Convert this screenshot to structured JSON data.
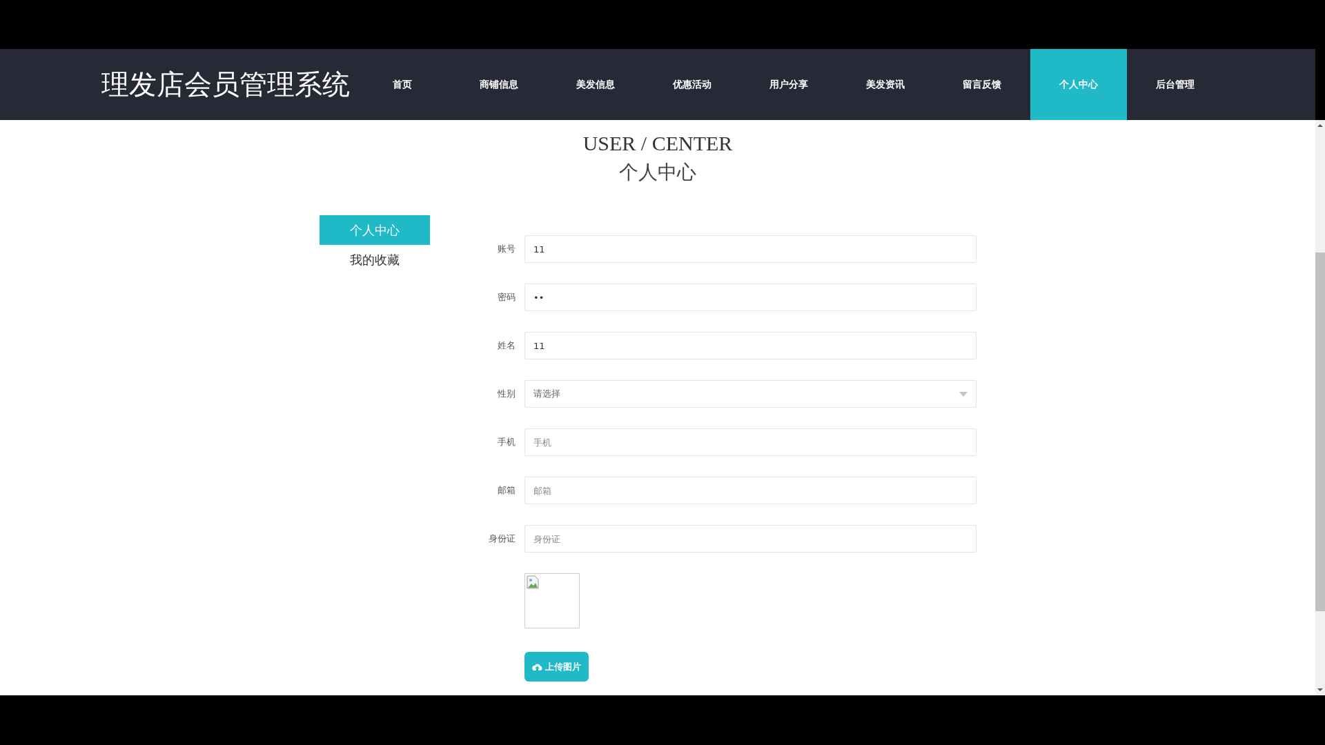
{
  "header": {
    "title": "理发店会员管理系统"
  },
  "nav": [
    {
      "label": "首页",
      "selected": false
    },
    {
      "label": "商铺信息",
      "selected": false
    },
    {
      "label": "美发信息",
      "selected": false
    },
    {
      "label": "优惠活动",
      "selected": false
    },
    {
      "label": "用户分享",
      "selected": false
    },
    {
      "label": "美发资讯",
      "selected": false
    },
    {
      "label": "留言反馈",
      "selected": false
    },
    {
      "label": "个人中心",
      "selected": true
    },
    {
      "label": "后台管理",
      "selected": false
    }
  ],
  "page_heading": {
    "english": "USER / CENTER",
    "chinese": "个人中心"
  },
  "sidebar": [
    {
      "label": "个人中心",
      "selected": true
    },
    {
      "label": "我的收藏",
      "selected": false
    }
  ],
  "form": [
    {
      "kind": "text",
      "label": "账号",
      "value": "11"
    },
    {
      "kind": "text",
      "label": "密码",
      "value": "••"
    },
    {
      "kind": "text",
      "label": "姓名",
      "value": "11"
    },
    {
      "kind": "select",
      "label": "性别",
      "placeholder": "请选择"
    },
    {
      "kind": "text",
      "label": "手机",
      "placeholder": "手机"
    },
    {
      "kind": "text",
      "label": "邮箱",
      "placeholder": "邮箱"
    },
    {
      "kind": "text",
      "label": "身份证",
      "placeholder": "身份证"
    }
  ],
  "upload": {
    "button": "上传图片"
  }
}
